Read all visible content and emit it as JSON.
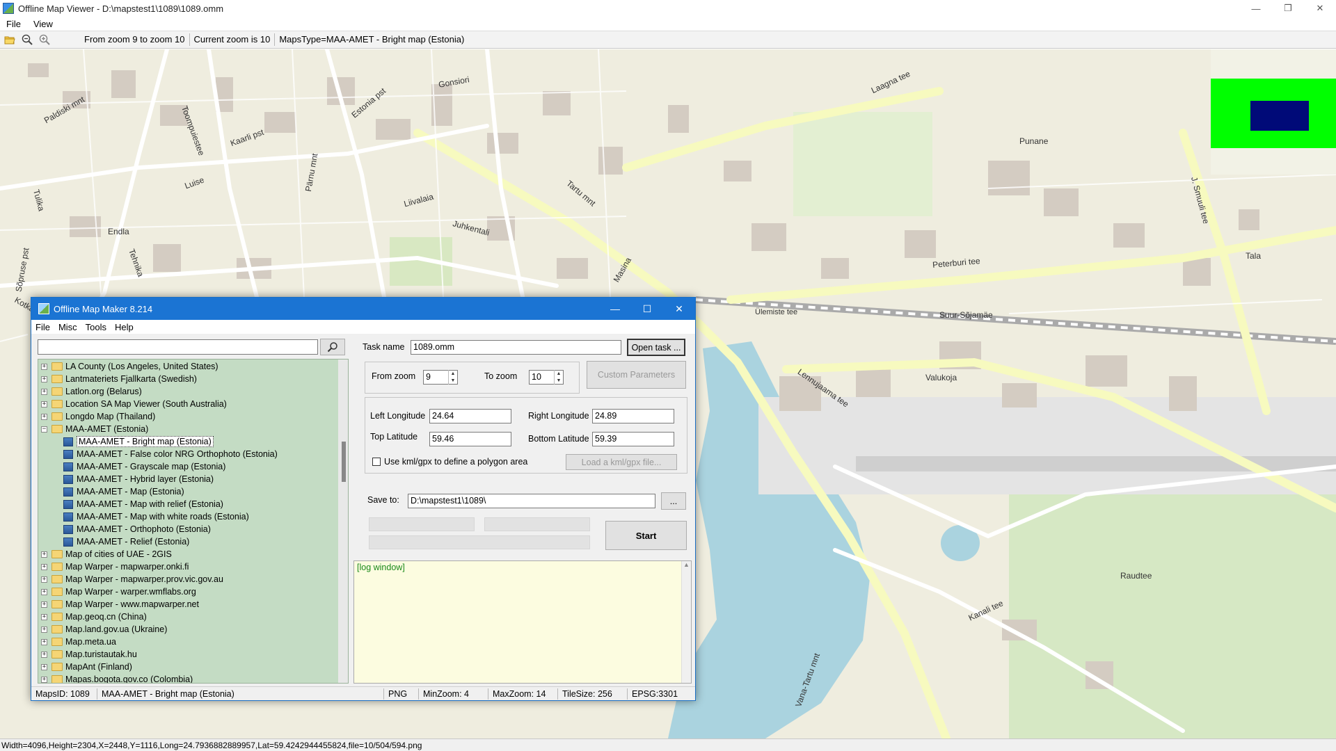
{
  "window": {
    "title": "Offline Map Viewer - D:\\mapstest1\\1089\\1089.omm",
    "controls": {
      "minimize": "—",
      "restore": "❐",
      "close": "✕"
    }
  },
  "menu": [
    "File",
    "View"
  ],
  "toolbar": {
    "icons": [
      "open-folder-icon",
      "zoom-out-icon",
      "zoom-in-icon"
    ],
    "zoom_range": "From zoom 9 to zoom 10",
    "current_zoom": "Current zoom is 10",
    "maps_type": "MapsType=MAA-AMET - Bright map (Estonia)"
  },
  "map": {
    "labels": [
      {
        "text": "Gonsiori"
      },
      {
        "text": "Laagna tee"
      },
      {
        "text": "Estonia pst"
      },
      {
        "text": "Paldiski mnt"
      },
      {
        "text": "Toompuiestee"
      },
      {
        "text": "Kaarli pst"
      },
      {
        "text": "Tartu mnt"
      },
      {
        "text": "Liivalaia"
      },
      {
        "text": "Juhkentali"
      },
      {
        "text": "Endla"
      },
      {
        "text": "Luise"
      },
      {
        "text": "Peterburi tee"
      },
      {
        "text": "Suur-Sõjamäe"
      },
      {
        "text": "Ülemiste tee"
      },
      {
        "text": "Lennujaama tee"
      },
      {
        "text": "Valukoja"
      },
      {
        "text": "Punane"
      },
      {
        "text": "Tulika"
      },
      {
        "text": "Vana-Tartu mnt"
      },
      {
        "text": "Kanali tee"
      },
      {
        "text": "Tala"
      },
      {
        "text": "J. Smuuli tee"
      },
      {
        "text": "Tehnika"
      },
      {
        "text": "Masina"
      },
      {
        "text": "Pärnu mnt"
      },
      {
        "text": "Sõpruse pst"
      },
      {
        "text": "Kotka"
      },
      {
        "text": "Raudtee"
      }
    ],
    "overview": {
      "frame": "#00ff00",
      "viewport": "#000a78"
    }
  },
  "statusbar": {
    "text": "Width=4096,Height=2304,X=2448,Y=1116,Long=24.7936882889957,Lat=59.4242944455824,file=10/504/594.png"
  },
  "dialog": {
    "title": "Offline Map Maker 8.214",
    "controls": {
      "minimize": "—",
      "maximize": "☐",
      "close": "✕"
    },
    "menu": [
      "File",
      "Misc",
      "Tools",
      "Help"
    ],
    "search": {
      "value": "",
      "button_icon": "search-icon"
    },
    "tree": [
      {
        "label": "LA County (Los Angeles, United States)",
        "type": "folder",
        "expanded": false
      },
      {
        "label": "Lantmateriets Fjallkarta (Swedish)",
        "type": "folder",
        "expanded": false
      },
      {
        "label": "Latlon.org (Belarus)",
        "type": "folder",
        "expanded": false
      },
      {
        "label": "Location SA Map Viewer (South Australia)",
        "type": "folder",
        "expanded": false
      },
      {
        "label": "Longdo Map (Thailand)",
        "type": "folder",
        "expanded": false
      },
      {
        "label": "MAA-AMET (Estonia)",
        "type": "folder",
        "expanded": true
      },
      {
        "label": "MAA-AMET - Bright map (Estonia)",
        "type": "map",
        "selected": true
      },
      {
        "label": "MAA-AMET - False color NRG Orthophoto (Estonia)",
        "type": "map"
      },
      {
        "label": "MAA-AMET - Grayscale map (Estonia)",
        "type": "map"
      },
      {
        "label": "MAA-AMET - Hybrid layer (Estonia)",
        "type": "map"
      },
      {
        "label": "MAA-AMET - Map (Estonia)",
        "type": "map"
      },
      {
        "label": "MAA-AMET - Map with relief (Estonia)",
        "type": "map"
      },
      {
        "label": "MAA-AMET - Map with white roads (Estonia)",
        "type": "map"
      },
      {
        "label": "MAA-AMET - Orthophoto (Estonia)",
        "type": "map"
      },
      {
        "label": "MAA-AMET - Relief (Estonia)",
        "type": "map"
      },
      {
        "label": "Map of cities of UAE - 2GIS",
        "type": "folder",
        "expanded": false
      },
      {
        "label": "Map Warper - mapwarper.onki.fi",
        "type": "folder",
        "expanded": false
      },
      {
        "label": "Map Warper - mapwarper.prov.vic.gov.au",
        "type": "folder",
        "expanded": false
      },
      {
        "label": "Map Warper - warper.wmflabs.org",
        "type": "folder",
        "expanded": false
      },
      {
        "label": "Map Warper - www.mapwarper.net",
        "type": "folder",
        "expanded": false
      },
      {
        "label": "Map.geoq.cn (China)",
        "type": "folder",
        "expanded": false
      },
      {
        "label": "Map.land.gov.ua (Ukraine)",
        "type": "folder",
        "expanded": false
      },
      {
        "label": "Map.meta.ua",
        "type": "folder",
        "expanded": false
      },
      {
        "label": "Map.turistautak.hu",
        "type": "folder",
        "expanded": false
      },
      {
        "label": "MapAnt (Finland)",
        "type": "folder",
        "expanded": false
      },
      {
        "label": "Mapas.bogota.gov.co (Colombia)",
        "type": "folder",
        "expanded": false
      }
    ],
    "task": {
      "label": "Task name",
      "value": "1089.omm",
      "open_button": "Open task ..."
    },
    "zoom": {
      "from_label": "From zoom",
      "from_value": "9",
      "to_label": "To zoom",
      "to_value": "10",
      "custom_button": "Custom Parameters"
    },
    "coords": {
      "left_lon_label": "Left Longitude",
      "left_lon": "24.64",
      "right_lon_label": "Right Longitude",
      "right_lon": "24.89",
      "top_lat_label": "Top Latitude",
      "top_lat": "59.46",
      "bottom_lat_label": "Bottom Latitude",
      "bottom_lat": "59.39",
      "kml_label": "Use kml/gpx to define a polygon area",
      "kml_button": "Load a kml/gpx file..."
    },
    "save": {
      "label": "Save to:",
      "value": "D:\\mapstest1\\1089\\",
      "browse_button": "..."
    },
    "start_button": "Start",
    "log": {
      "text": "[log window]"
    },
    "status": {
      "maps_id": "MapsID: 1089",
      "maps_name": "MAA-AMET - Bright map (Estonia)",
      "format": "PNG",
      "min_zoom": "MinZoom: 4",
      "max_zoom": "MaxZoom: 14",
      "tile_size": "TileSize: 256",
      "epsg": "EPSG:3301"
    }
  }
}
